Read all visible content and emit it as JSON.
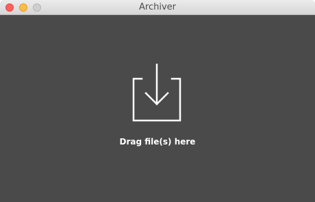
{
  "window": {
    "title": "Archiver"
  },
  "drop_zone": {
    "label": "Drag file(s) here",
    "icon": "download-into-tray-icon"
  },
  "colors": {
    "content_background": "#4a4a4a",
    "close": "#fc605c",
    "minimize": "#fdbc40",
    "zoom": "#cfcfcf",
    "icon_and_text": "#ffffff"
  }
}
